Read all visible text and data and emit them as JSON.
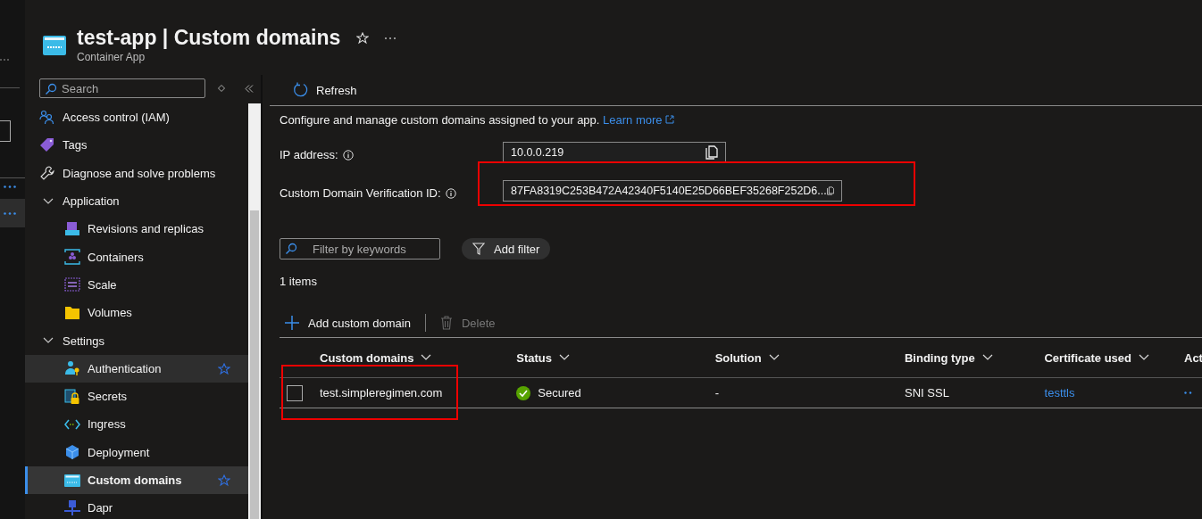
{
  "header": {
    "title": "test-app | Custom domains",
    "subtitle": "Container App"
  },
  "sidebar": {
    "search": {
      "placeholder": "Search"
    },
    "items": [
      {
        "label": "Access control (IAM)",
        "kind": "item",
        "selected": false
      },
      {
        "label": "Tags",
        "kind": "item",
        "selected": false
      },
      {
        "label": "Diagnose and solve problems",
        "kind": "item",
        "selected": false
      },
      {
        "label": "Application",
        "kind": "group",
        "expanded": true,
        "children": [
          {
            "label": "Revisions and replicas",
            "selected": false,
            "favorite": false
          },
          {
            "label": "Containers",
            "selected": false,
            "favorite": false
          },
          {
            "label": "Scale",
            "selected": false,
            "favorite": false
          },
          {
            "label": "Volumes",
            "selected": false,
            "favorite": false
          }
        ]
      },
      {
        "label": "Settings",
        "kind": "group",
        "expanded": true,
        "children": [
          {
            "label": "Authentication",
            "selected": false,
            "favorite": true
          },
          {
            "label": "Secrets",
            "selected": false,
            "favorite": false
          },
          {
            "label": "Ingress",
            "selected": false,
            "favorite": false
          },
          {
            "label": "Deployment",
            "selected": false,
            "favorite": false
          },
          {
            "label": "Custom domains",
            "selected": true,
            "favorite": true
          },
          {
            "label": "Dapr",
            "selected": false,
            "favorite": false
          }
        ]
      }
    ]
  },
  "toolbar": {
    "refresh": "Refresh"
  },
  "description": {
    "text": "Configure and manage custom domains assigned to your app.",
    "link": "Learn more"
  },
  "fields": [
    {
      "label": "IP address:",
      "value": "10.0.0.219",
      "highlighted": false
    },
    {
      "label": "Custom Domain Verification ID:",
      "value": "87FA8319C253B472A42340F5140E25D66BEF35268F252D6...",
      "highlighted": true
    }
  ],
  "filter": {
    "placeholder": "Filter by keywords",
    "add_filter": "Add filter"
  },
  "count": "1 items",
  "commands": [
    {
      "label": "Add custom domain",
      "disabled": false,
      "kind": "add"
    },
    {
      "label": "Delete",
      "disabled": true,
      "kind": "delete"
    }
  ],
  "table": {
    "columns": [
      "Custom domains",
      "Status",
      "Solution",
      "Binding type",
      "Certificate used",
      "Act"
    ],
    "rows": [
      {
        "checked": false,
        "highlighted": true,
        "domain": "test.simpleregimen.com",
        "status": "Secured",
        "solution": "-",
        "binding": "SNI SSL",
        "certificate": "testtls"
      }
    ]
  }
}
